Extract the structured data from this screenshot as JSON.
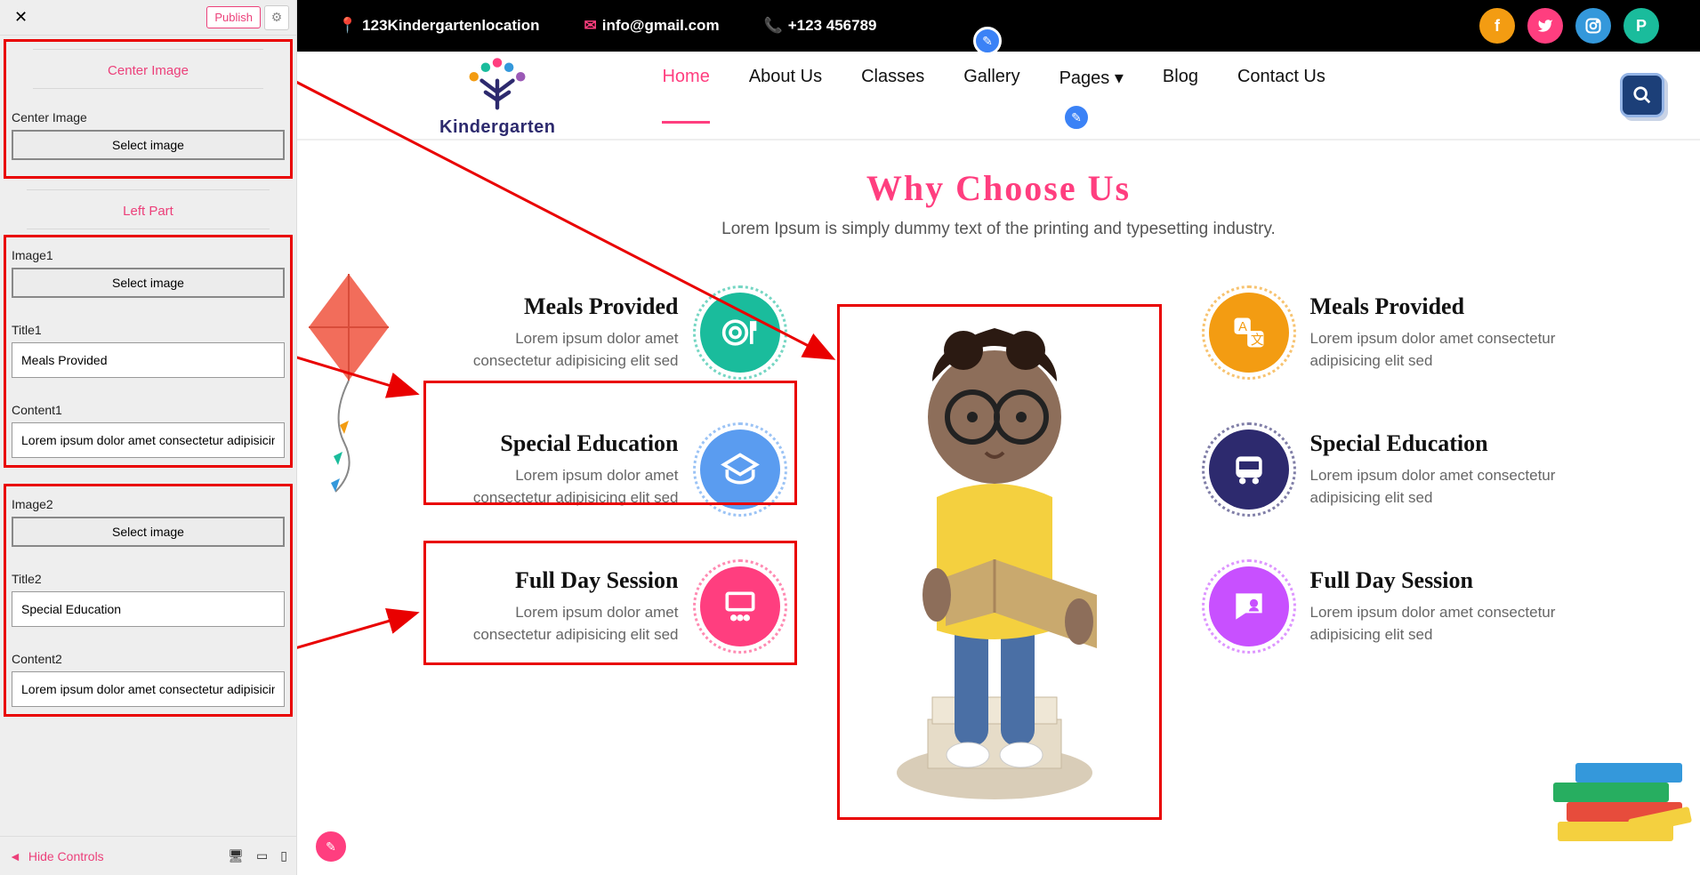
{
  "sidebar": {
    "publish": "Publish",
    "centerImage": {
      "heading": "Center Image",
      "label": "Center Image",
      "button": "Select image"
    },
    "leftPart": {
      "heading": "Left Part",
      "image1": {
        "label": "Image1",
        "button": "Select image"
      },
      "title1": {
        "label": "Title1",
        "value": "Meals Provided"
      },
      "content1": {
        "label": "Content1",
        "value": "Lorem ipsum dolor amet consectetur adipisicing eli"
      },
      "image2": {
        "label": "Image2",
        "button": "Select image"
      },
      "title2": {
        "label": "Title2",
        "value": "Special Education"
      },
      "content2": {
        "label": "Content2",
        "value": "Lorem ipsum dolor amet consectetur adipisicing eli"
      }
    },
    "hideControls": "Hide Controls"
  },
  "topbar": {
    "address": "123Kindergartenlocation",
    "email": "info@gmail.com",
    "phone": "+123 456789"
  },
  "logo": "Kindergarten",
  "nav": [
    "Home",
    "About Us",
    "Classes",
    "Gallery",
    "Pages",
    "Blog",
    "Contact Us"
  ],
  "section": {
    "title": "Why Choose Us",
    "subtitle": "Lorem Ipsum is simply dummy text of the printing and typesetting industry."
  },
  "features": {
    "left": [
      {
        "title": "Meals Provided",
        "desc": "Lorem ipsum dolor amet consectetur adipisicing elit sed"
      },
      {
        "title": "Special Education",
        "desc": "Lorem ipsum dolor amet consectetur adipisicing elit sed"
      },
      {
        "title": "Full Day Session",
        "desc": "Lorem ipsum dolor amet consectetur adipisicing elit sed"
      }
    ],
    "right": [
      {
        "title": "Meals Provided",
        "desc": "Lorem ipsum dolor amet consectetur adipisicing elit sed"
      },
      {
        "title": "Special Education",
        "desc": "Lorem ipsum dolor amet consectetur adipisicing elit sed"
      },
      {
        "title": "Full Day Session",
        "desc": "Lorem ipsum dolor amet consectetur adipisicing elit sed"
      }
    ]
  }
}
